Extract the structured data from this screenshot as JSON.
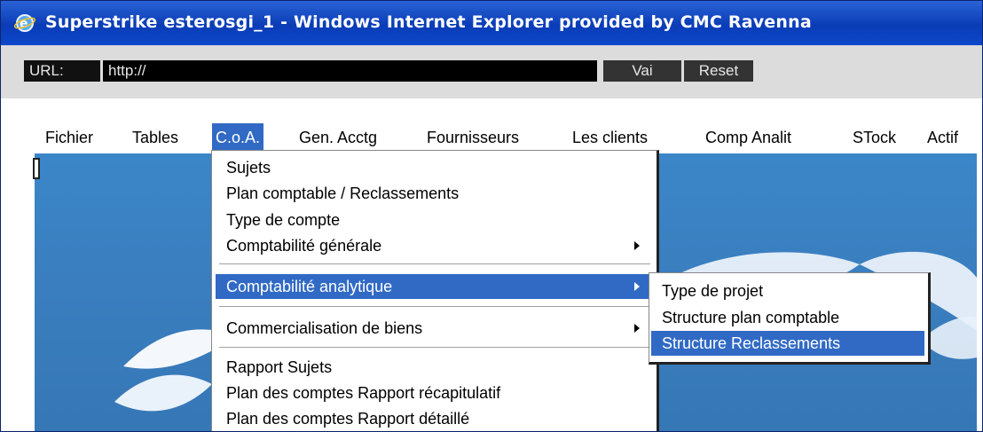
{
  "window": {
    "title": "Superstrike esterosgi_1 - Windows Internet Explorer provided by CMC Ravenna"
  },
  "urlbar": {
    "label": "URL:",
    "value": "http://",
    "go_label": "Vai",
    "reset_label": "Reset"
  },
  "menubar": {
    "items": [
      {
        "label": "Fichier"
      },
      {
        "label": "Tables"
      },
      {
        "label": "C.o.A."
      },
      {
        "label": "Gen. Acctg"
      },
      {
        "label": "Fournisseurs"
      },
      {
        "label": "Les clients"
      },
      {
        "label": "Comp Analit"
      },
      {
        "label": "STock"
      },
      {
        "label": "Actif"
      }
    ]
  },
  "dropdown": {
    "items": [
      {
        "label": "Sujets"
      },
      {
        "label": "Plan comptable / Reclassements"
      },
      {
        "label": "Type de compte"
      },
      {
        "label": "Comptabilité générale"
      },
      {
        "label": "Comptabilité analytique"
      },
      {
        "label": "Commercialisation de biens"
      },
      {
        "label": "Rapport Sujets"
      },
      {
        "label": "Plan des comptes Rapport récapitulatif"
      },
      {
        "label": "Plan des comptes Rapport détaillé"
      }
    ]
  },
  "submenu": {
    "items": [
      {
        "label": "Type de projet"
      },
      {
        "label": "Structure plan comptable"
      },
      {
        "label": "Structure Reclassements"
      }
    ]
  },
  "colors": {
    "titlebar": "#0a3cb6",
    "highlight": "#316ac5",
    "hero_blue": "#3a7fc0"
  }
}
